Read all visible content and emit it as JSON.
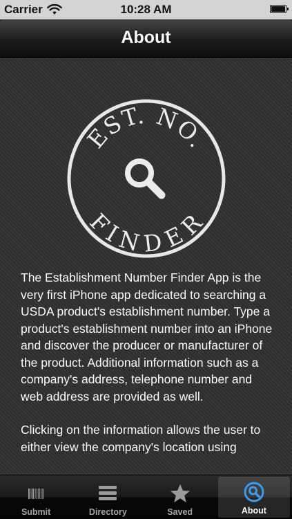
{
  "status_bar": {
    "carrier": "Carrier",
    "time": "10:28 AM"
  },
  "nav": {
    "title": "About"
  },
  "logo": {
    "top_text": "EST. NO.",
    "bottom_text": "FINDER"
  },
  "content": {
    "paragraphs": [
      "The Establishment Number Finder App is the very first iPhone app dedicated to searching a USDA product's establishment number. Type a product's establishment number into an iPhone and discover the producer or manufacturer of the product. Additional information such as a company's address, telephone number and web address are provided as well.",
      "Clicking on the information allows the user to either view the company's location using"
    ]
  },
  "tabs": [
    {
      "label": "Submit",
      "icon": "barcode-icon",
      "active": false
    },
    {
      "label": "Directory",
      "icon": "list-icon",
      "active": false
    },
    {
      "label": "Saved",
      "icon": "star-icon",
      "active": false
    },
    {
      "label": "About",
      "icon": "search-icon",
      "active": true
    }
  ],
  "colors": {
    "background": "#303030",
    "active_tab_icon": "#3d9be9",
    "inactive_tab_icon": "#9a9a9a"
  }
}
